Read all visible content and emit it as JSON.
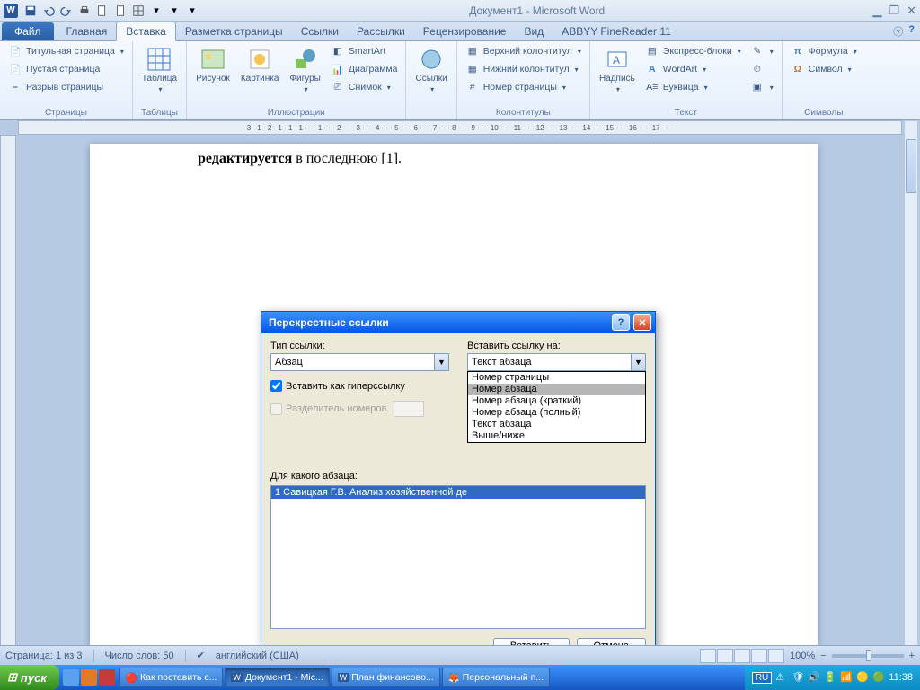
{
  "title": "Документ1 - Microsoft Word",
  "file_tab": "Файл",
  "tabs": [
    "Главная",
    "Вставка",
    "Разметка страницы",
    "Ссылки",
    "Рассылки",
    "Рецензирование",
    "Вид",
    "ABBYY FineReader 11"
  ],
  "active_tab_index": 1,
  "ribbon": {
    "pages_group": {
      "label": "Страницы",
      "title_page": "Титульная страница",
      "blank_page": "Пустая страница",
      "page_break": "Разрыв страницы"
    },
    "tables_group": {
      "label": "Таблицы",
      "table": "Таблица"
    },
    "illustrations_group": {
      "label": "Иллюстрации",
      "picture": "Рисунок",
      "clipart": "Картинка",
      "shapes": "Фигуры",
      "smartart": "SmartArt",
      "chart": "Диаграмма",
      "screenshot": "Снимок"
    },
    "links_group": {
      "label": "",
      "links": "Ссылки"
    },
    "headerfooter_group": {
      "label": "Колонтитулы",
      "header": "Верхний колонтитул",
      "footer": "Нижний колонтитул",
      "pagenum": "Номер страницы"
    },
    "text_group": {
      "label": "Текст",
      "textbox": "Надпись",
      "quickparts": "Экспресс-блоки",
      "wordart": "WordArt",
      "dropcap": "Буквица"
    },
    "symbols_group": {
      "label": "Символы",
      "equation": "Формула",
      "symbol": "Символ"
    }
  },
  "ruler_marks": "3 · 1 · 2 · 1 · 1 · 1 · · · 1 · · · 2 · · · 3 · · · 4 · · · 5 · · · 6 · · · 7 · · · 8 · · · 9 · · · 10 · · · 11 · · · 12 · · · 13 · · · 14 · · · 15 · · · 16 · · · 17 · · ·",
  "document_text": {
    "bold": "редактируется",
    "rest": " в последнюю [1]."
  },
  "dialog": {
    "title": "Перекрестные ссылки",
    "ref_type_label": "Тип ссылки:",
    "ref_type_value": "Абзац",
    "insert_ref_label": "Вставить ссылку на:",
    "insert_ref_value": "Текст абзаца",
    "insert_ref_options": [
      "Номер страницы",
      "Номер абзаца",
      "Номер абзаца (краткий)",
      "Номер абзаца (полный)",
      "Текст абзаца",
      "Выше/ниже"
    ],
    "hyperlink_check": "Вставить как гиперссылку",
    "separator_check": "Разделитель номеров",
    "for_which_label": "Для какого абзаца:",
    "para_item": "1 Савицкая Г.В. Анализ хозяйственной де",
    "insert_btn": "Вставить",
    "cancel_btn": "Отмена"
  },
  "status": {
    "page": "Страница: 1 из 3",
    "words": "Число слов: 50",
    "lang": "английский (США)",
    "zoom": "100%"
  },
  "taskbar": {
    "start": "пуск",
    "items": [
      "Как поставить с...",
      "Документ1 - Mic...",
      "План финансово...",
      "Персональный п..."
    ],
    "active_index": 1,
    "lang": "RU",
    "time": "11:38"
  }
}
